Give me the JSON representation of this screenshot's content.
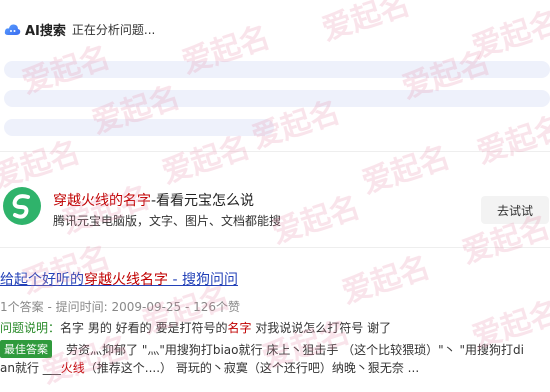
{
  "ai_search": {
    "title": "AI搜索",
    "status": "正在分析问题..."
  },
  "ad": {
    "title_highlight": "穿越火线的名字",
    "title_rest": "-看看元宝怎么说",
    "description": "腾讯元宝电脑版，文字、图片、文档都能搜",
    "button_label": "去试试"
  },
  "result": {
    "title_prefix": "给起个好听的",
    "title_highlight": "穿越火线名字",
    "title_suffix": " - 搜狗问问",
    "meta": "1个答案 - 提问时间: 2009-09-25 - 126个赞",
    "question_label": "问题说明：",
    "question_a": "名字 男的 好看的 要是打符号的",
    "question_hl": "名字",
    "question_b": " 对我说说怎么打符号 谢了",
    "best_answer_badge": "最佳答案",
    "answer_line1": "劳资灬抑郁了 \"灬\"用搜狗打biao就行 床上丶狙击手 （这个比较猥琐）\"丶 \"用搜狗打di",
    "answer_line2_a": "an就行 ___",
    "answer_line2_hl": "火线",
    "answer_line2_b": "（推荐这个....） 哥玩的丶寂寞（这个还行吧）纳晚丶狠无奈 ..."
  },
  "watermark": "爱起名",
  "colors": {
    "highlight_red": "#c00000",
    "link_blue": "#2442b8",
    "badge_green": "#2f9a3c",
    "skeleton": "#eef1fb",
    "watermark_pink": "#e88aa6"
  }
}
